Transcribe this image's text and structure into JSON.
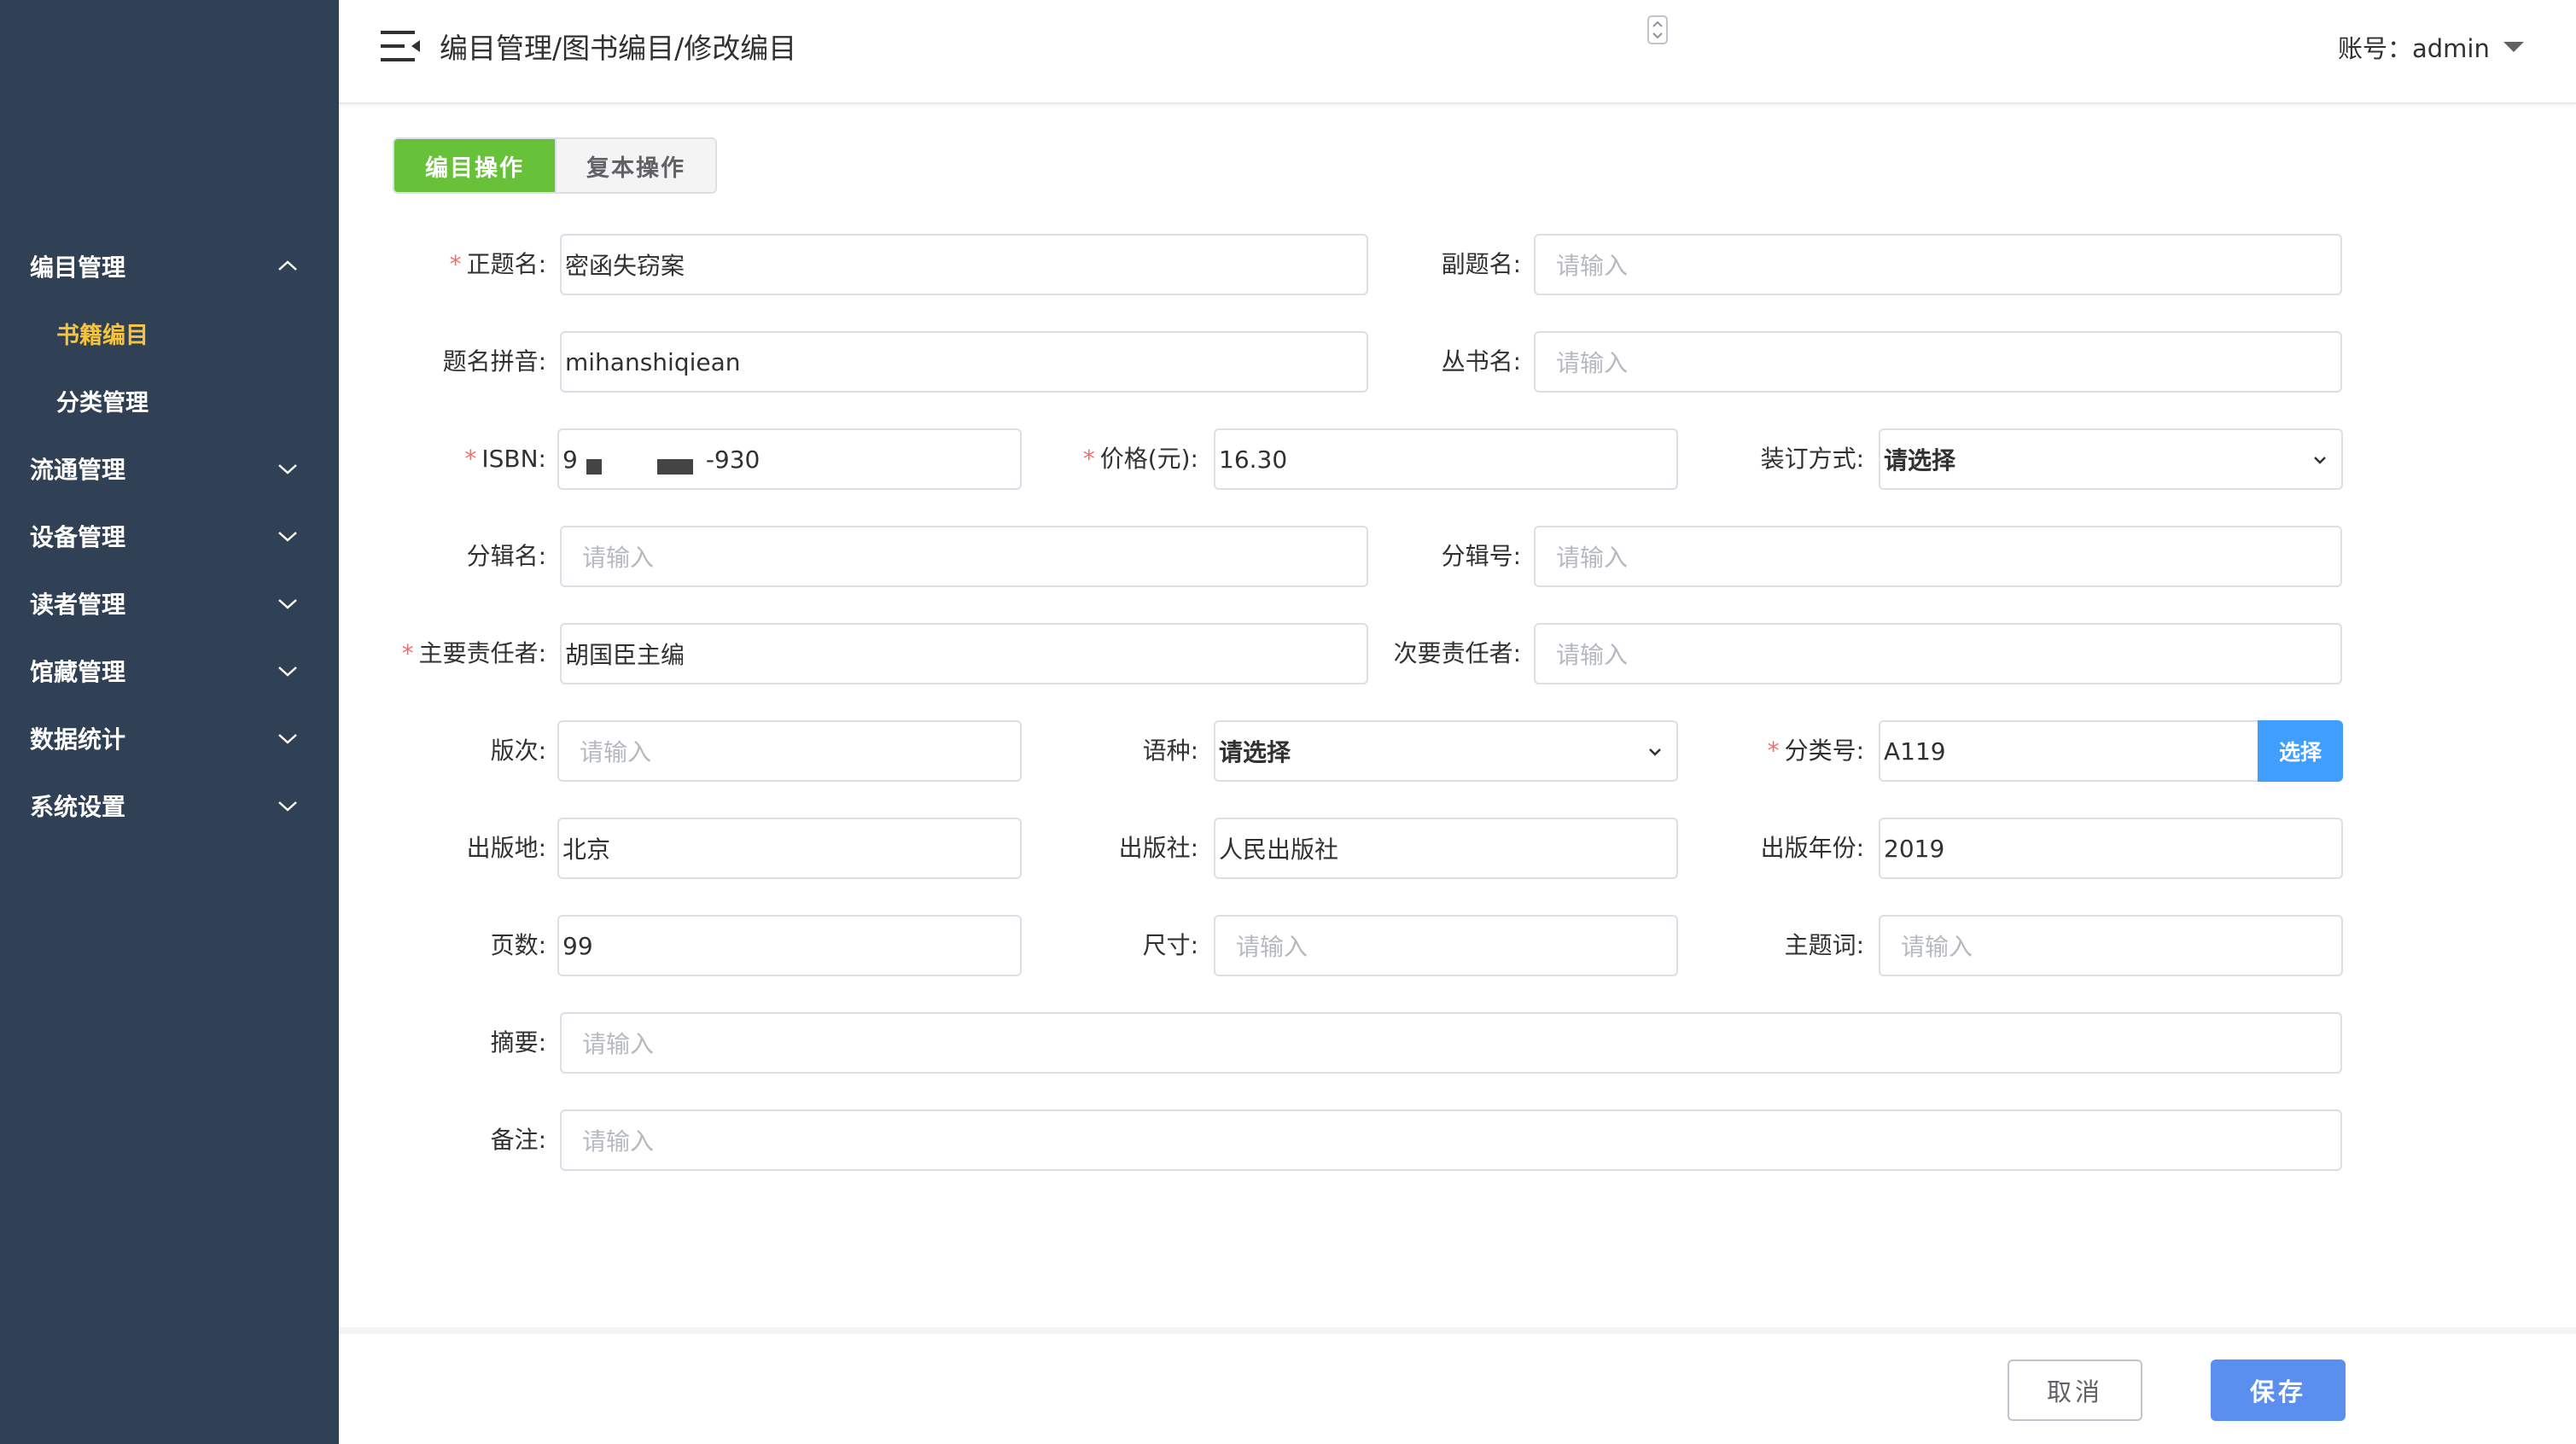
{
  "sidebar": {
    "items": [
      {
        "label": "编目管理",
        "expanded": true,
        "chevron": "chevron-up-icon"
      },
      {
        "label": "流通管理",
        "expanded": false,
        "chevron": "chevron-down-icon"
      },
      {
        "label": "设备管理",
        "expanded": false,
        "chevron": "chevron-down-icon"
      },
      {
        "label": "读者管理",
        "expanded": false,
        "chevron": "chevron-down-icon"
      },
      {
        "label": "馆藏管理",
        "expanded": false,
        "chevron": "chevron-down-icon"
      },
      {
        "label": "数据统计",
        "expanded": false,
        "chevron": "chevron-down-icon"
      },
      {
        "label": "系统设置",
        "expanded": false,
        "chevron": "chevron-down-icon"
      }
    ],
    "sub_items": [
      {
        "label": "书籍编目",
        "active": true
      },
      {
        "label": "分类管理",
        "active": false
      }
    ],
    "colors": {
      "background": "#304156",
      "active_text": "#f7c33b"
    }
  },
  "header": {
    "breadcrumb": "编目管理/图书编目/修改编目",
    "account": "账号：admin",
    "menu_icon": "menu-fold-icon",
    "caret_icon": "caret-down-icon"
  },
  "tabs": [
    {
      "label": "编目操作",
      "active": true
    },
    {
      "label": "复本操作",
      "active": false
    }
  ],
  "form": {
    "title": {
      "label": "正题名:",
      "value": "密函失窃案",
      "required": true
    },
    "subtitle": {
      "label": "副题名:",
      "placeholder": "请输入"
    },
    "pinyin": {
      "label": "题名拼音:",
      "value": "mihanshiqiean"
    },
    "series": {
      "label": "丛书名:",
      "placeholder": "请输入"
    },
    "isbn": {
      "label": "ISBN:",
      "value_prefix": "9",
      "value_suffix": "-930",
      "required": true
    },
    "price": {
      "label": "价格(元):",
      "value": "16.30",
      "required": true
    },
    "binding": {
      "label": "装订方式:",
      "value": "请选择"
    },
    "part_name": {
      "label": "分辑名:",
      "placeholder": "请输入"
    },
    "part_no": {
      "label": "分辑号:",
      "placeholder": "请输入"
    },
    "main_author": {
      "label": "主要责任者:",
      "value": "胡国臣主编",
      "required": true
    },
    "secondary_author": {
      "label": "次要责任者:",
      "placeholder": "请输入"
    },
    "edition": {
      "label": "版次:",
      "placeholder": "请输入"
    },
    "language": {
      "label": "语种:",
      "value": "请选择"
    },
    "class_no": {
      "label": "分类号:",
      "value": "A119",
      "required": true,
      "button": "选择"
    },
    "pub_place": {
      "label": "出版地:",
      "value": "北京"
    },
    "publisher": {
      "label": "出版社:",
      "value": "人民出版社"
    },
    "pub_year": {
      "label": "出版年份:",
      "value": "2019"
    },
    "pages": {
      "label": "页数:",
      "value": "99"
    },
    "size": {
      "label": "尺寸:",
      "placeholder": "请输入"
    },
    "subject": {
      "label": "主题词:",
      "placeholder": "请输入"
    },
    "abstract": {
      "label": "摘要:",
      "placeholder": "请输入"
    },
    "remark": {
      "label": "备注:",
      "placeholder": "请输入"
    }
  },
  "footer": {
    "cancel": "取消",
    "save": "保存"
  },
  "colors": {
    "tab_active": "#67c23a",
    "primary": "#409eff",
    "save_button": "#5a8ff0",
    "required_star": "#f56c6c"
  }
}
